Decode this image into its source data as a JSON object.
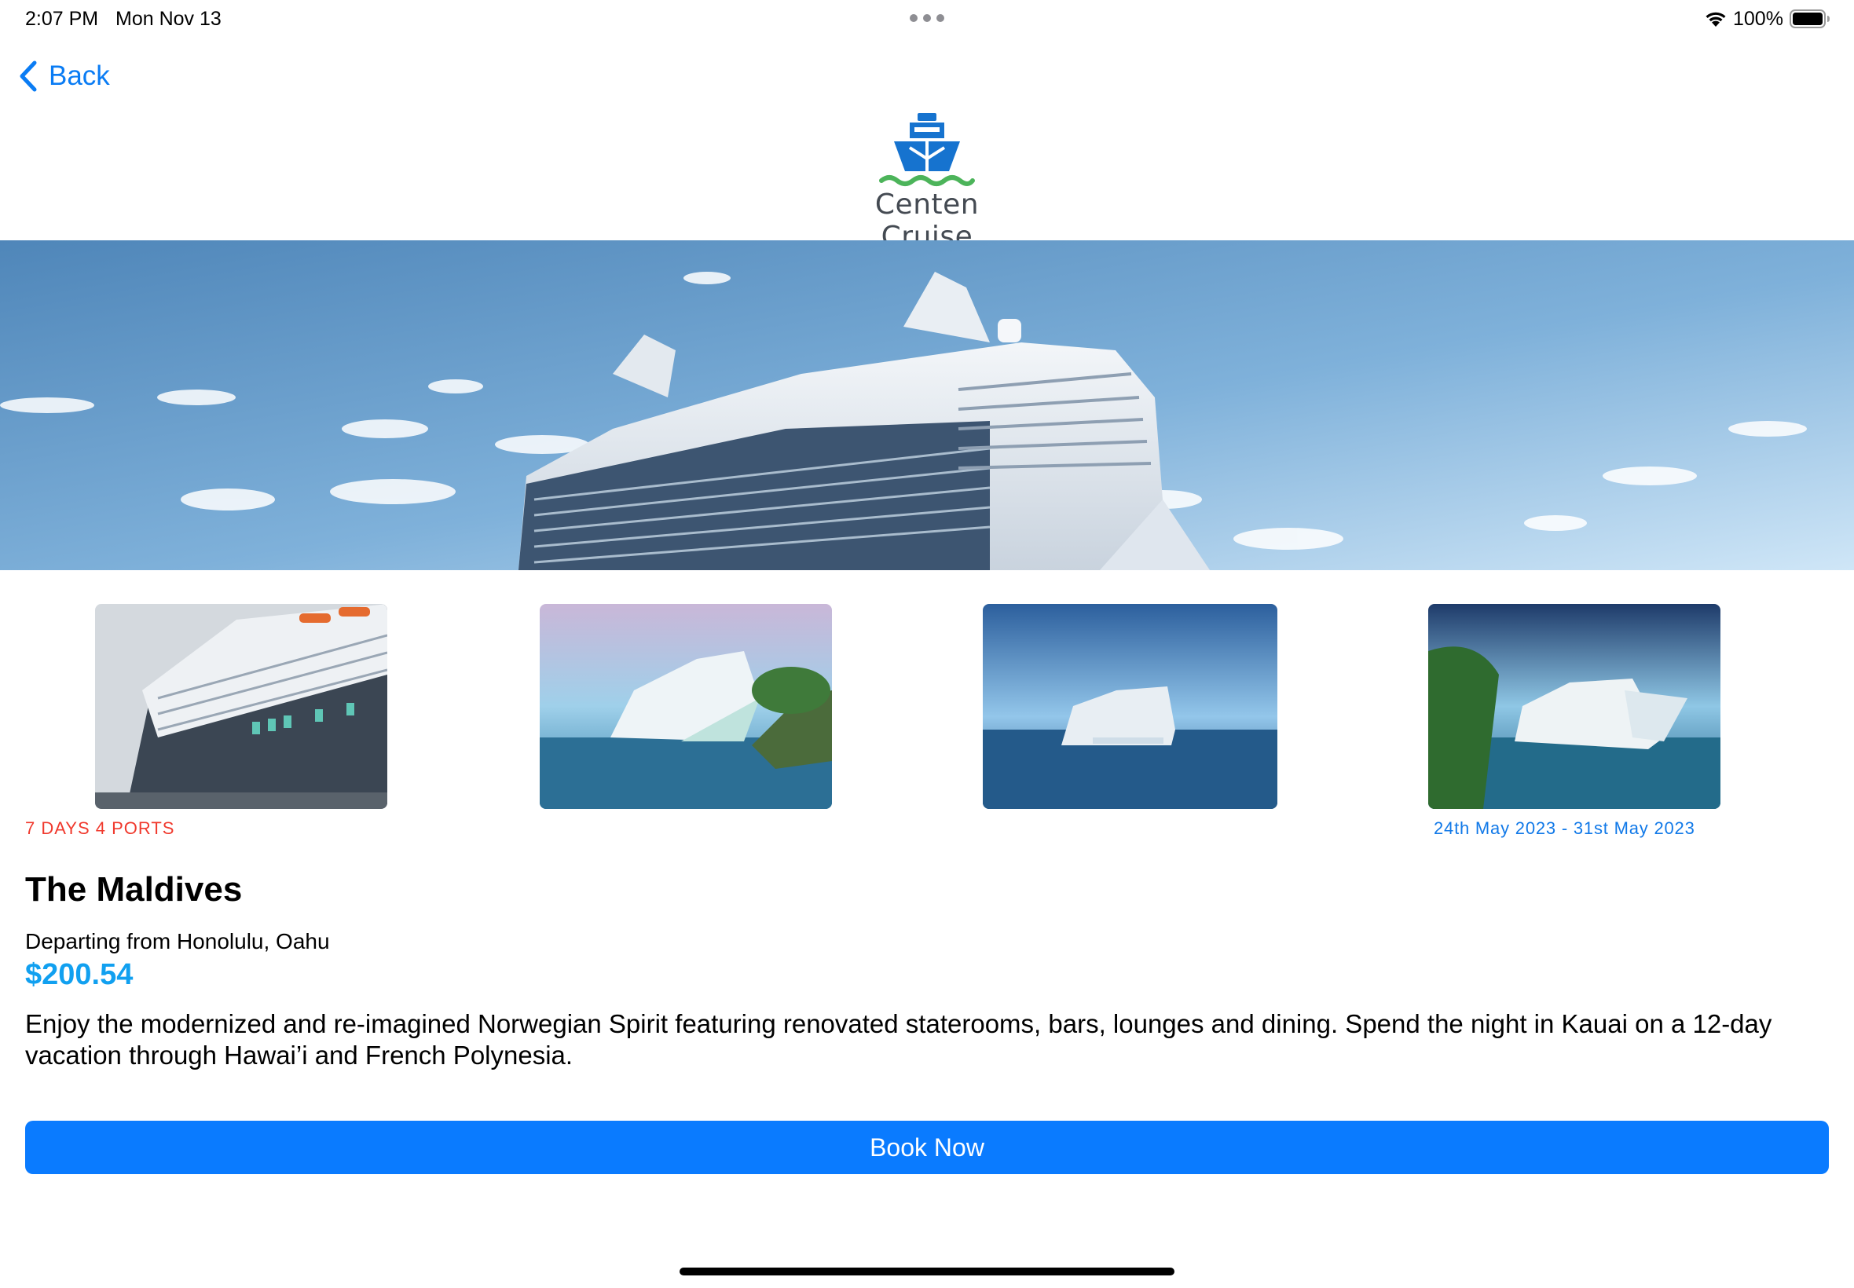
{
  "status_bar": {
    "time": "2:07 PM",
    "date": "Mon Nov 13",
    "battery": "100%"
  },
  "nav": {
    "back_label": "Back"
  },
  "brand": {
    "name": "Centen Cruise"
  },
  "trip": {
    "meta": "7 DAYS 4 PORTS",
    "dates": "24th May 2023 - 31st May 2023",
    "title": "The Maldives",
    "departure": "Departing from Honolulu, Oahu",
    "price": "$200.54",
    "description": "Enjoy the modernized and re-imagined Norwegian Spirit featuring renovated staterooms, bars, lounges and dining. Spend the night in Kauai on a 12-day vacation through Hawai’i and French Polynesia."
  },
  "actions": {
    "book_label": "Book Now"
  },
  "icons": {
    "back": "chevron-left-icon",
    "wifi": "wifi-icon",
    "battery": "battery-icon",
    "logo": "ship-logo-icon"
  },
  "colors": {
    "accent": "#0a7bff",
    "link": "#0a7cf4",
    "meta_red": "#f0392d",
    "price_blue": "#11a0f0",
    "logo_blue": "#1673cf",
    "logo_green": "#4cb45a"
  }
}
